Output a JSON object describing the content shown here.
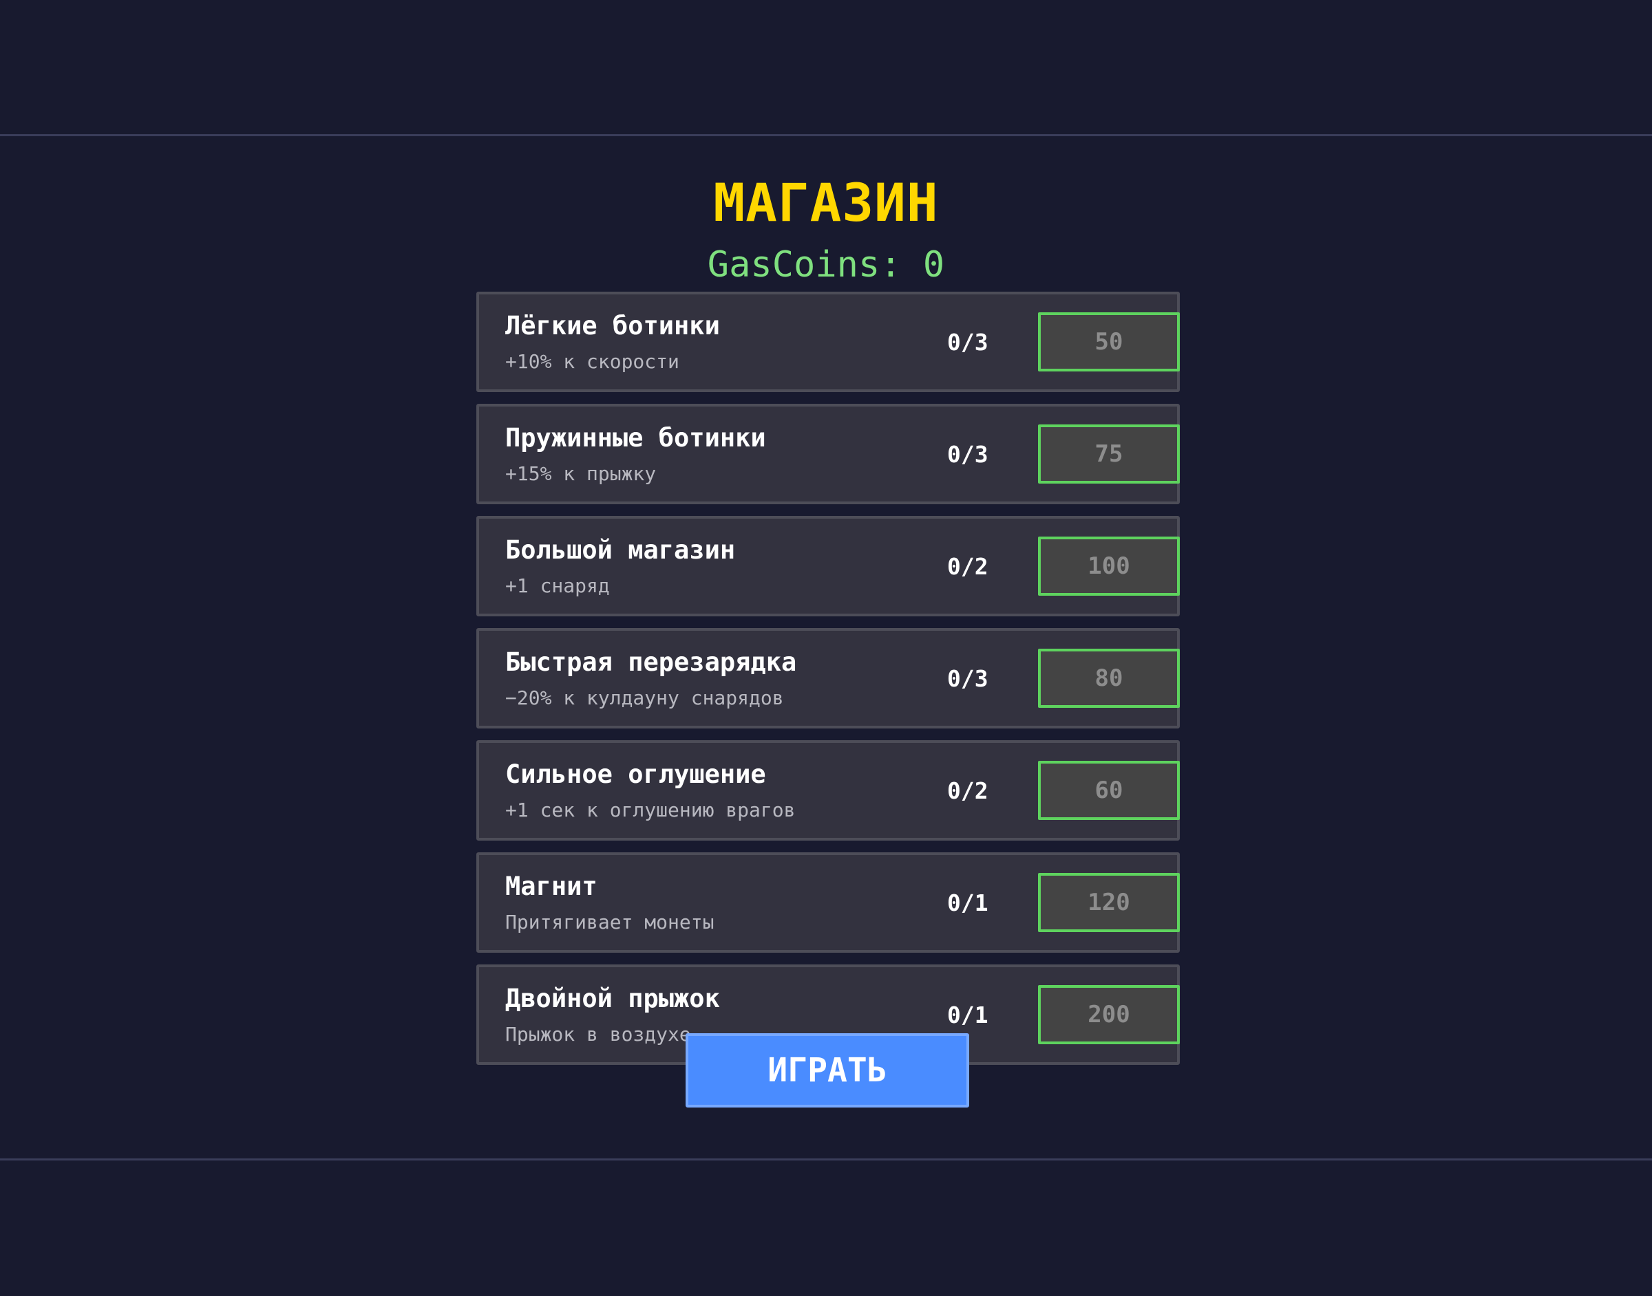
{
  "shop": {
    "title": "МАГАЗИН",
    "coins_label": "GasCoins:",
    "coins_value": "0"
  },
  "items": [
    {
      "name": "Лёгкие ботинки",
      "desc": "+10% к скорости",
      "level": "0/3",
      "price": "50"
    },
    {
      "name": "Пружинные ботинки",
      "desc": "+15% к прыжку",
      "level": "0/3",
      "price": "75"
    },
    {
      "name": "Большой магазин",
      "desc": "+1 снаряд",
      "level": "0/2",
      "price": "100"
    },
    {
      "name": "Быстрая перезарядка",
      "desc": "−20% к кулдауну снарядов",
      "level": "0/3",
      "price": "80"
    },
    {
      "name": "Сильное оглушение",
      "desc": "+1 сек к оглушению врагов",
      "level": "0/2",
      "price": "60"
    },
    {
      "name": "Магнит",
      "desc": "Притягивает монеты",
      "level": "0/1",
      "price": "120"
    },
    {
      "name": "Двойной прыжок",
      "desc": "Прыжок в воздухе",
      "level": "0/1",
      "price": "200"
    }
  ],
  "play_button": {
    "label": "ИГРАТЬ"
  },
  "colors": {
    "background": "#181a2f",
    "title": "#ffd700",
    "coins": "#7fe07f",
    "buy_border": "#5ed35e",
    "play_button": "#4a8cff"
  }
}
